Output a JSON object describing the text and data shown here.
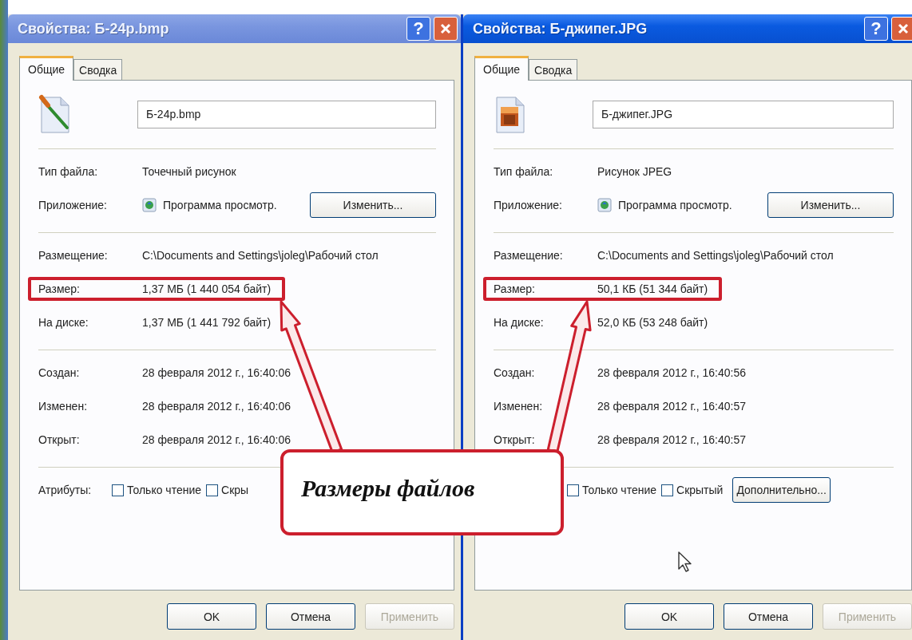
{
  "dialogs": [
    {
      "title": "Свойства: Б-24р.bmp",
      "active": false,
      "help_button": "?",
      "tabs": [
        {
          "label": "Общие",
          "selected": true
        },
        {
          "label": "Сводка",
          "selected": false
        }
      ],
      "file_name": "Б-24р.bmp",
      "sections": [
        [
          {
            "kind": "text",
            "label": "Тип файла:",
            "value": "Точечный рисунок",
            "highlighted": false
          },
          {
            "kind": "app",
            "label": "Приложение:",
            "value": "Программа просмотр.",
            "button": "Изменить...",
            "highlighted": false
          }
        ],
        [
          {
            "kind": "text",
            "label": "Размещение:",
            "value": "C:\\Documents and Settings\\joleg\\Рабочий стол",
            "highlighted": false
          },
          {
            "kind": "text",
            "label": "Размер:",
            "value": "1,37 МБ (1 440 054 байт)",
            "highlighted": true
          },
          {
            "kind": "text",
            "label": "На диске:",
            "value": "1,37 МБ (1 441 792 байт)",
            "highlighted": false
          }
        ],
        [
          {
            "kind": "text",
            "label": "Создан:",
            "value": "28 февраля 2012 г., 16:40:06",
            "highlighted": false
          },
          {
            "kind": "text",
            "label": "Изменен:",
            "value": "28 февраля 2012 г., 16:40:06",
            "highlighted": false
          },
          {
            "kind": "text",
            "label": "Открыт:",
            "value": "28 февраля 2012 г., 16:40:06",
            "highlighted": false
          }
        ]
      ],
      "attributes": {
        "label": "Атрибуты:",
        "checkboxes": [
          {
            "label": "Только чтение",
            "checked": false
          },
          {
            "label": "Скры",
            "checked": false
          }
        ]
      },
      "buttons": [
        {
          "label": "OK",
          "disabled": false
        },
        {
          "label": "Отмена",
          "disabled": false
        },
        {
          "label": "Применить",
          "disabled": true
        }
      ]
    },
    {
      "title": "Свойства: Б-джипег.JPG",
      "active": true,
      "help_button": "?",
      "tabs": [
        {
          "label": "Общие",
          "selected": true
        },
        {
          "label": "Сводка",
          "selected": false
        }
      ],
      "file_name": "Б-джипег.JPG",
      "sections": [
        [
          {
            "kind": "text",
            "label": "Тип файла:",
            "value": "Рисунок JPEG",
            "highlighted": false
          },
          {
            "kind": "app",
            "label": "Приложение:",
            "value": "Программа просмотр.",
            "button": "Изменить...",
            "highlighted": false
          }
        ],
        [
          {
            "kind": "text",
            "label": "Размещение:",
            "value": "C:\\Documents and Settings\\joleg\\Рабочий стол",
            "highlighted": false
          },
          {
            "kind": "text",
            "label": "Размер:",
            "value": "50,1 КБ (51 344 байт)",
            "highlighted": true
          },
          {
            "kind": "text",
            "label": "На диске:",
            "value": "52,0 КБ (53 248 байт)",
            "highlighted": false
          }
        ],
        [
          {
            "kind": "text",
            "label": "Создан:",
            "value": "28 февраля 2012 г., 16:40:56",
            "highlighted": false
          },
          {
            "kind": "text",
            "label": "Изменен:",
            "value": "28 февраля 2012 г., 16:40:57",
            "highlighted": false
          },
          {
            "kind": "text",
            "label": "Открыт:",
            "value": "28 февраля 2012 г., 16:40:57",
            "highlighted": false
          }
        ]
      ],
      "attributes": {
        "checkboxes": [
          {
            "label": "Только чтение",
            "checked": false
          },
          {
            "label": "Скрытый",
            "checked": false
          }
        ],
        "button": "Дополнительно..."
      },
      "buttons": [
        {
          "label": "OK",
          "disabled": false
        },
        {
          "label": "Отмена",
          "disabled": false
        },
        {
          "label": "Применить",
          "disabled": true
        }
      ]
    }
  ],
  "annotation": {
    "callout": "Размеры файлов"
  }
}
